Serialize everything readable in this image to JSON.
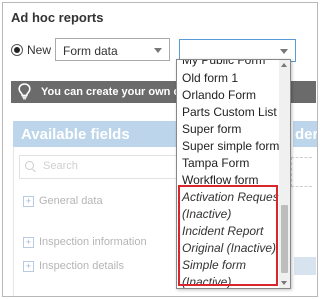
{
  "header": {
    "title": "Ad hoc reports"
  },
  "mode": {
    "radio_label": "New"
  },
  "form_type_select": {
    "value": "Form data"
  },
  "form_select": {
    "value": ""
  },
  "info_bar": {
    "text": "You can create your own custo"
  },
  "available_fields": {
    "title": "Available fields",
    "search_placeholder": "Search",
    "groups": [
      "General data",
      "Inspection information",
      "Inspection details"
    ]
  },
  "right_panel": {
    "title_fragment": "der"
  },
  "dropdown": {
    "options": [
      "My Public Form",
      "Old form 1",
      "Orlando Form",
      "Parts Custom List",
      "Super form",
      "Super simple form",
      "Tampa Form",
      "Workflow form",
      "Activation Request",
      "(Inactive)",
      "Incident Report",
      "Original (Inactive)",
      "Simple form",
      "(Inactive)"
    ]
  },
  "colors": {
    "highlight_border": "#d8262c",
    "panel_header": "#bcd5ea",
    "info_bar": "#6b6b6b",
    "select_focus": "#5b9bd5"
  }
}
